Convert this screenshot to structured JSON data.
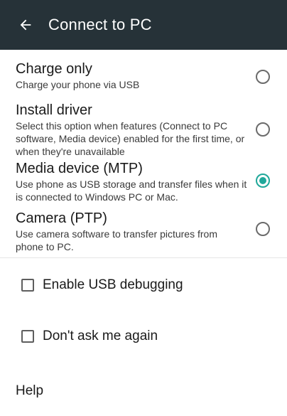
{
  "toolbar": {
    "title": "Connect to PC",
    "back_icon": "arrow-left-icon"
  },
  "options": [
    {
      "title": "Charge only",
      "description": "Charge your phone via USB",
      "selected": false
    },
    {
      "title": "Install driver",
      "description": "Select this option when features (Connect to PC software, Media device) enabled for the first time, or when they're unavailable",
      "selected": false
    },
    {
      "title": "Media device (MTP)",
      "description": "Use phone as USB storage and transfer files when it is connected to Windows PC or Mac.",
      "selected": true
    },
    {
      "title": "Camera (PTP)",
      "description": "Use camera software to transfer pictures from phone to PC.",
      "selected": false
    }
  ],
  "checkboxes": {
    "usb_debugging": "Enable USB debugging",
    "dont_ask": "Don't ask me again"
  },
  "help_label": "Help",
  "colors": {
    "toolbar_bg": "#263238",
    "accent": "#20a89a"
  }
}
